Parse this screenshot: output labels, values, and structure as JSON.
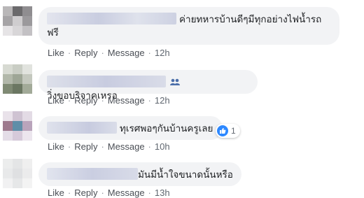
{
  "comments": [
    {
      "text_line1": "ค่ายทหารบ้านดีๆมีทุกอย่างไฟน้ำรถ",
      "text_line2": "ฟรี",
      "actions": {
        "like": "Like",
        "reply": "Reply",
        "message": "Message",
        "time": "12h"
      }
    },
    {
      "text": "วิ่งขอบริจาคเหรอ",
      "group_icon": "group-icon",
      "actions": {
        "like": "Like",
        "reply": "Reply",
        "message": "Message",
        "time": "12h"
      }
    },
    {
      "text": "ทุเรศพอๆกันบ้านครูเลย",
      "reaction_icon": "like-icon",
      "reaction_count": "1",
      "actions": {
        "like": "Like",
        "reply": "Reply",
        "message": "Message",
        "time": "10h"
      }
    },
    {
      "text": "มันมีน้ำใจขนาดนั้นหรือ",
      "actions": {
        "like": "Like",
        "reply": "Reply",
        "message": "Message",
        "time": "13h"
      }
    }
  ],
  "colors": {
    "bubble": "#f2f3f5",
    "link": "#606770",
    "like_blue": "#2d88ff"
  }
}
